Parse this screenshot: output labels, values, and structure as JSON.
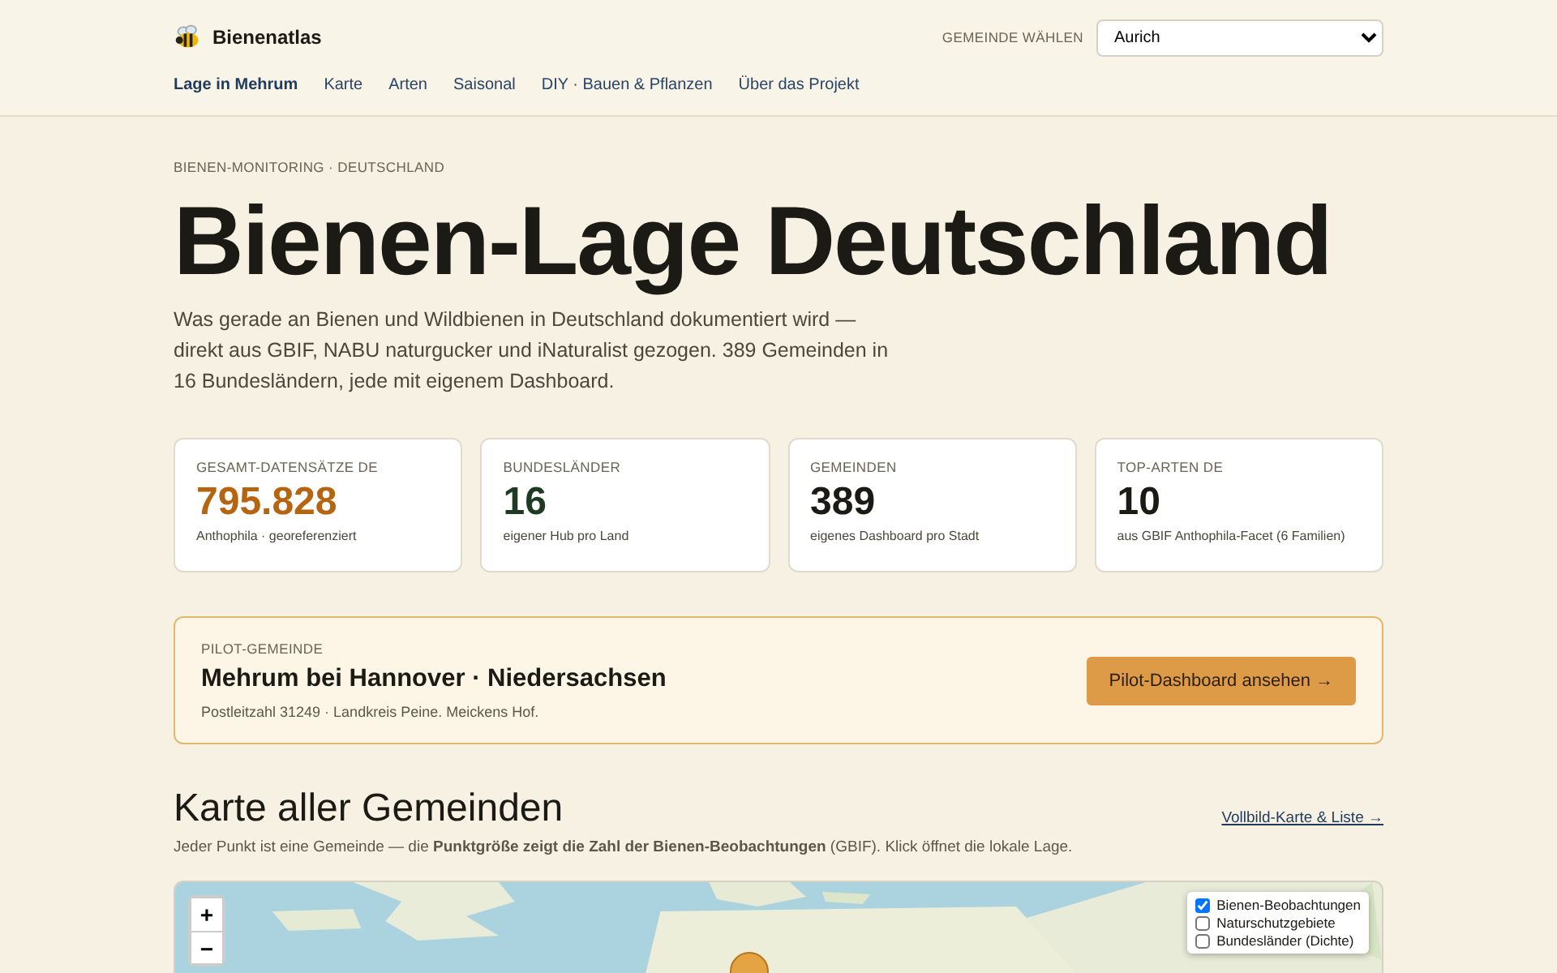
{
  "header": {
    "brand": "Bienenatlas",
    "select_label": "GEMEINDE WÄHLEN",
    "select_value": "Aurich"
  },
  "nav": [
    {
      "label": "Lage in Mehrum",
      "selected": true
    },
    {
      "label": "Karte",
      "selected": false
    },
    {
      "label": "Arten",
      "selected": false
    },
    {
      "label": "Saisonal",
      "selected": false
    },
    {
      "label": "DIY · Bauen & Pflanzen",
      "selected": false
    },
    {
      "label": "Über das Projekt",
      "selected": false
    }
  ],
  "hero": {
    "eyebrow": "BIENEN-MONITORING · DEUTSCHLAND",
    "title": "Bienen-Lage Deutschland",
    "intro": "Was gerade an Bienen und Wildbienen in Deutschland dokumentiert wird — direkt aus GBIF, NABU naturgucker und iNaturalist gezogen. 389 Gemeinden in 16 Bundesländern, jede mit eigenem Dashboard."
  },
  "stats": [
    {
      "label": "GESAMT-DATENSÄTZE DE",
      "value": "795.828",
      "note": "Anthophila · georeferenziert",
      "color": "#b5650f"
    },
    {
      "label": "BUNDESLÄNDER",
      "value": "16",
      "note": "eigener Hub pro Land",
      "color": "#1f3a24"
    },
    {
      "label": "GEMEINDEN",
      "value": "389",
      "note": "eigenes Dashboard pro Stadt",
      "color": "#1c1a14"
    },
    {
      "label": "TOP-ARTEN DE",
      "value": "10",
      "note": "aus GBIF Anthophila-Facet (6 Familien)",
      "color": "#1c1a14"
    }
  ],
  "pilot": {
    "eyebrow": "PILOT-GEMEINDE",
    "title": "Mehrum bei Hannover · Niedersachsen",
    "note": "Postleitzahl 31249 · Landkreis Peine. Meickens Hof.",
    "button": "Pilot-Dashboard ansehen →"
  },
  "map_section": {
    "title": "Karte aller Gemeinden",
    "link": "Vollbild-Karte & Liste →",
    "description": "Jeder Punkt ist eine Gemeinde — die **Punktgröße zeigt die Zahl der Bienen-Beobachtungen** (GBIF). Klick öffnet die lokale Lage.",
    "zoom_in": "+",
    "zoom_out": "−",
    "layers": [
      {
        "label": "Bienen-Beobachtungen",
        "checked": true
      },
      {
        "label": "Naturschutzgebiete",
        "checked": false
      },
      {
        "label": "Bundesländer (Dichte)",
        "checked": false
      }
    ]
  }
}
